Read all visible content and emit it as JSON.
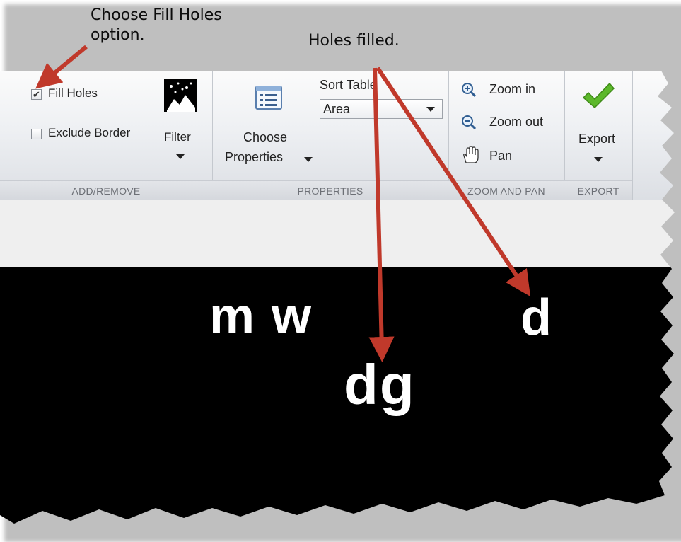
{
  "callouts": {
    "fill_holes": "Choose Fill Holes\noption.",
    "holes_filled": "Holes filled."
  },
  "ribbon": {
    "add_remove": {
      "fill_holes_label": "Fill Holes",
      "fill_holes_checked": true,
      "exclude_border_label": "Exclude Border",
      "exclude_border_checked": false,
      "filter_label": "Filter",
      "group_label": "ADD/REMOVE"
    },
    "properties": {
      "choose_label_1": "Choose",
      "choose_label_2": "Properties",
      "sort_label": "Sort Table",
      "sort_value": "Area",
      "group_label": "PROPERTIES"
    },
    "zoom_pan": {
      "zoom_in": "Zoom in",
      "zoom_out": "Zoom out",
      "pan": "Pan",
      "group_label": "ZOOM AND PAN"
    },
    "export": {
      "label": "Export",
      "group_label": "EXPORT"
    }
  },
  "image": {
    "blob_mw": "m w",
    "blob_d": "d",
    "blob_dg": "dg"
  },
  "colors": {
    "annotation_arrow": "#c0392b",
    "export_check": "#5cb82b"
  }
}
